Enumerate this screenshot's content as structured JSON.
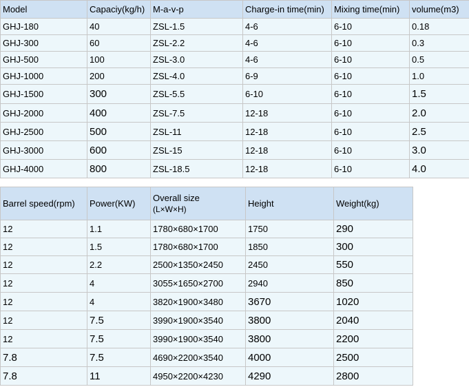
{
  "table1": {
    "headers": [
      "Model",
      "Capaciy(kg/h)",
      "M-a-v-p",
      "Charge-in time(min)",
      "Mixing time(min)",
      "volume(m3)"
    ],
    "rows": [
      [
        "GHJ-180",
        "40",
        "ZSL-1.5",
        "4-6",
        "6-10",
        "0.18"
      ],
      [
        "GHJ-300",
        "60",
        "ZSL-2.2",
        "4-6",
        "6-10",
        "0.3"
      ],
      [
        "GHJ-500",
        "100",
        "ZSL-3.0",
        "4-6",
        "6-10",
        "0.5"
      ],
      [
        "GHJ-1000",
        "200",
        "ZSL-4.0",
        "6-9",
        "6-10",
        "1.0"
      ],
      [
        "GHJ-1500",
        "300",
        "ZSL-5.5",
        "6-10",
        "6-10",
        "1.5"
      ],
      [
        "GHJ-2000",
        "400",
        "ZSL-7.5",
        "12-18",
        "6-10",
        "2.0"
      ],
      [
        "GHJ-2500",
        "500",
        "ZSL-11",
        "12-18",
        "6-10",
        "2.5"
      ],
      [
        "GHJ-3000",
        "600",
        "ZSL-15",
        "12-18",
        "6-10",
        "3.0"
      ],
      [
        "GHJ-4000",
        "800",
        "ZSL-18.5",
        "12-18",
        "6-10",
        "4.0"
      ]
    ]
  },
  "table2": {
    "headers": [
      "Barrel speed(rpm)",
      "Power(KW)",
      "Overall size",
      "Height",
      "Weight(kg)"
    ],
    "header_sub": "(L×W×H)",
    "rows": [
      [
        "12",
        "1.1",
        "1780×680×1700",
        "1750",
        "290"
      ],
      [
        "12",
        "1.5",
        "1780×680×1700",
        "1850",
        "300"
      ],
      [
        "12",
        "2.2",
        "2500×1350×2450",
        "2450",
        "550"
      ],
      [
        "12",
        "4",
        "3055×1650×2700",
        "2940",
        "850"
      ],
      [
        "12",
        "4",
        "3820×1900×3480",
        "3670",
        "1020"
      ],
      [
        "12",
        "7.5",
        "3990×1900×3540",
        "3800",
        "2040"
      ],
      [
        "12",
        "7.5",
        "3990×1900×3540",
        "3800",
        "2200"
      ],
      [
        "7.8",
        "7.5",
        "4690×2200×3540",
        "4000",
        "2500"
      ],
      [
        "7.8",
        "11",
        "4950×2200×4230",
        "4290",
        "2800"
      ]
    ]
  }
}
